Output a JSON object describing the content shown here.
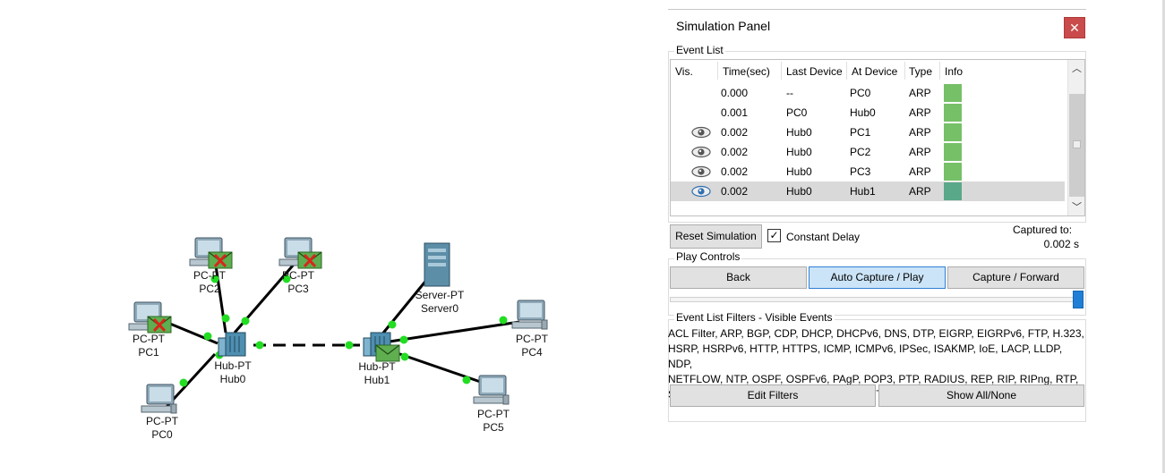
{
  "topology": {
    "devices": [
      {
        "type_label": "PC-PT",
        "name": "PC0"
      },
      {
        "type_label": "PC-PT",
        "name": "PC1"
      },
      {
        "type_label": "PC-PT",
        "name": "PC2"
      },
      {
        "type_label": "PC-PT",
        "name": "PC3"
      },
      {
        "type_label": "Hub-PT",
        "name": "Hub0"
      },
      {
        "type_label": "Hub-PT",
        "name": "Hub1"
      },
      {
        "type_label": "Server-PT",
        "name": "Server0"
      },
      {
        "type_label": "PC-PT",
        "name": "PC4"
      },
      {
        "type_label": "PC-PT",
        "name": "PC5"
      }
    ]
  },
  "panel": {
    "title": "Simulation Panel",
    "close_icon": "close-icon",
    "event_list": {
      "title": "Event List",
      "columns": [
        "Vis.",
        "Time(sec)",
        "Last Device",
        "At Device",
        "Type",
        "Info"
      ],
      "rows": [
        {
          "visible": false,
          "time": "0.000",
          "last": "--",
          "at": "PC0",
          "type": "ARP",
          "info_color": "#76c068",
          "selected": false
        },
        {
          "visible": false,
          "time": "0.001",
          "last": "PC0",
          "at": "Hub0",
          "type": "ARP",
          "info_color": "#76c068",
          "selected": false
        },
        {
          "visible": true,
          "time": "0.002",
          "last": "Hub0",
          "at": "PC1",
          "type": "ARP",
          "info_color": "#76c068",
          "selected": false
        },
        {
          "visible": true,
          "time": "0.002",
          "last": "Hub0",
          "at": "PC2",
          "type": "ARP",
          "info_color": "#76c068",
          "selected": false
        },
        {
          "visible": true,
          "time": "0.002",
          "last": "Hub0",
          "at": "PC3",
          "type": "ARP",
          "info_color": "#76c068",
          "selected": false
        },
        {
          "visible": true,
          "time": "0.002",
          "last": "Hub0",
          "at": "Hub1",
          "type": "ARP",
          "info_color": "#5aa88a",
          "selected": true
        }
      ]
    },
    "reset_label": "Reset Simulation",
    "constant_delay_label": "Constant Delay",
    "constant_delay_checked": true,
    "captured_label": "Captured to:",
    "captured_value": "0.002 s",
    "play_controls": {
      "title": "Play Controls",
      "back_label": "Back",
      "auto_label": "Auto Capture / Play",
      "forward_label": "Capture / Forward",
      "speed": 1.0
    },
    "filters": {
      "title": "Event List Filters - Visible Events",
      "text": "ACL Filter, ARP, BGP, CDP, DHCP, DHCPv6, DNS, DTP, EIGRP, EIGRPv6, FTP, H.323,\nHSRP, HSRPv6, HTTP, HTTPS, ICMP, ICMPv6, IPSec, ISAKMP, IoE, LACP, LLDP, NDP,\nNETFLOW, NTP, OSPF, OSPFv6, PAgP, POP3, PTP, RADIUS, REP, RIP, RIPng, RTP,\nSCCP, SMTP, SNMP, SSH, STP, SYSLOG, TACACS, TCP, TFTP, Telnet, UDP, VTP",
      "edit_label": "Edit Filters",
      "show_all_label": "Show All/None"
    }
  },
  "colors": {
    "link_dot": "#22dd22",
    "close": "#c94b4b",
    "active_button": "#cce4f7"
  }
}
